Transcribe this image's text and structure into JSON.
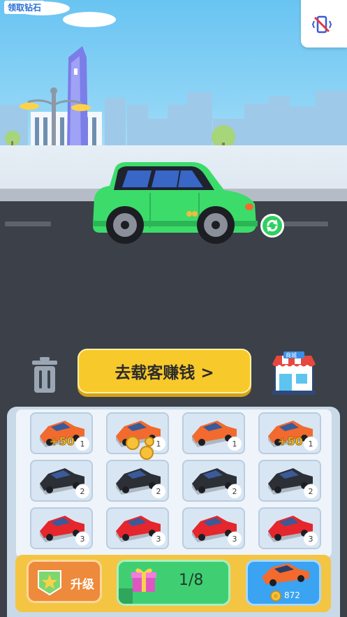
{
  "header": {
    "diamond_link": "领取钻石"
  },
  "scene": {
    "car_color": "#3cdc6a"
  },
  "actions": {
    "earn_label": "去载客赚钱 >",
    "shop_sign": "商城"
  },
  "garage": {
    "slots": [
      {
        "color": "#f26a2e",
        "level": "1",
        "bonus": "+50"
      },
      {
        "color": "#f26a2e",
        "level": "1",
        "bonus": ""
      },
      {
        "color": "#f26a2e",
        "level": "1",
        "bonus": ""
      },
      {
        "color": "#f26a2e",
        "level": "1",
        "bonus": "+50"
      },
      {
        "color": "#2c2f36",
        "level": "2",
        "bonus": ""
      },
      {
        "color": "#2c2f36",
        "level": "2",
        "bonus": ""
      },
      {
        "color": "#2c2f36",
        "level": "2",
        "bonus": ""
      },
      {
        "color": "#2c2f36",
        "level": "2",
        "bonus": ""
      },
      {
        "color": "#e5262d",
        "level": "3",
        "bonus": ""
      },
      {
        "color": "#e5262d",
        "level": "3",
        "bonus": ""
      },
      {
        "color": "#e5262d",
        "level": "3",
        "bonus": ""
      },
      {
        "color": "#e5262d",
        "level": "3",
        "bonus": ""
      }
    ]
  },
  "bottom": {
    "upgrade_label": "升级",
    "gift_progress": "1/8",
    "gift_fraction": 0.125,
    "buy_price": "872",
    "buy_car_color": "#f26a2e"
  }
}
